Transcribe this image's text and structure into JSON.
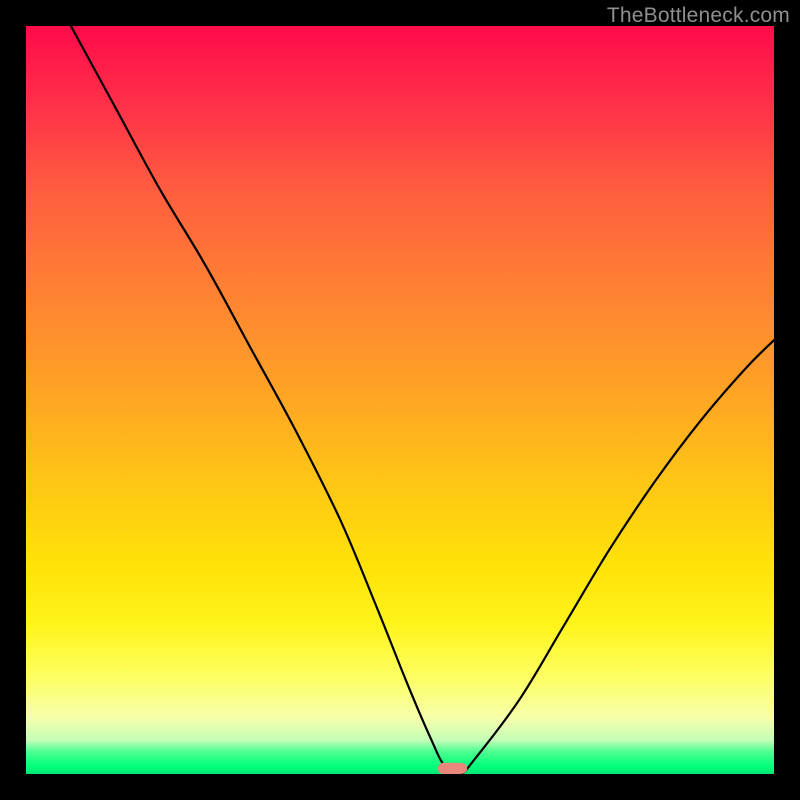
{
  "attribution": "TheBottleneck.com",
  "colors": {
    "frame": "#000000",
    "gradient_top": "#ff0b4a",
    "gradient_mid": "#ffe208",
    "gradient_bottom": "#00e574",
    "curve": "#000000",
    "marker": "#e8887d",
    "attribution_text": "#8f8f8f"
  },
  "chart_data": {
    "type": "line",
    "title": "",
    "xlabel": "",
    "ylabel": "",
    "xlim": [
      0,
      100
    ],
    "ylim": [
      0,
      100
    ],
    "grid": false,
    "series": [
      {
        "name": "bottleneck-curve",
        "x": [
          6,
          12,
          18,
          24,
          30,
          36,
          42,
          47,
          51,
          54,
          56,
          58,
          60,
          66,
          72,
          78,
          84,
          90,
          96,
          100
        ],
        "y": [
          100,
          89,
          78,
          68,
          57,
          46,
          34,
          22,
          12,
          5,
          1,
          0,
          2,
          10,
          20,
          30,
          39,
          47,
          54,
          58
        ]
      }
    ],
    "marker": {
      "x": 57,
      "y": 0,
      "width": 4,
      "height": 1.5,
      "shape": "rounded-rect"
    },
    "notes": "Values are read off the plot in percent of the 748x748 plotting area; y=0 is bottom, y=100 is top."
  }
}
